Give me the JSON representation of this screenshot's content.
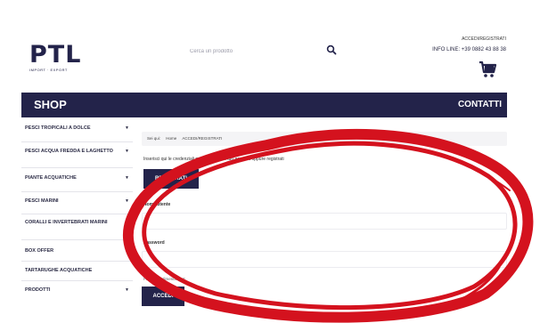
{
  "header": {
    "logo_text": "PTL",
    "logo_sub": "IMPORT · EXPORT",
    "search_placeholder": "Cerca un prodotto",
    "account_link": "ACCEDI/REGISTRATI",
    "info_line": "INFO LINE: +39 0882 43 88 38"
  },
  "nav": {
    "shop": "SHOP",
    "contact": "CONTATTI"
  },
  "sidebar": {
    "items": [
      {
        "label": "PESCI TROPICALI A DOLCE",
        "has_arrow": true
      },
      {
        "label": "PESCI ACQUA FREDDA E LAGHETTO",
        "has_arrow": true
      },
      {
        "label": "PIANTE ACQUATICHE",
        "has_arrow": true
      },
      {
        "label": "PESCI MARINI",
        "has_arrow": true
      },
      {
        "label": "CORALLI E INVERTEBRATI MARINI",
        "has_arrow": true
      },
      {
        "label": "BOX OFFER",
        "has_arrow": false
      },
      {
        "label": "TARTARUGHE ACQUATICHE",
        "has_arrow": false
      },
      {
        "label": "PRODOTTI",
        "has_arrow": true
      }
    ],
    "arrow_glyph": "▼"
  },
  "main": {
    "breadcrumb": [
      "Sei qui:",
      "Home",
      "ACCEDI/REGISTRATI"
    ],
    "intro_text": "Inserisci qui le credenziali per accedere al tuo account oppure registrati",
    "register_button": "REGISTRATI",
    "username_label": "Nome utente",
    "password_label": "Password",
    "forgot_link": "Password dimenticata?",
    "login_button": "ACCEDI"
  },
  "colors": {
    "brand": "#23234a",
    "annotation": "#d4121e"
  }
}
